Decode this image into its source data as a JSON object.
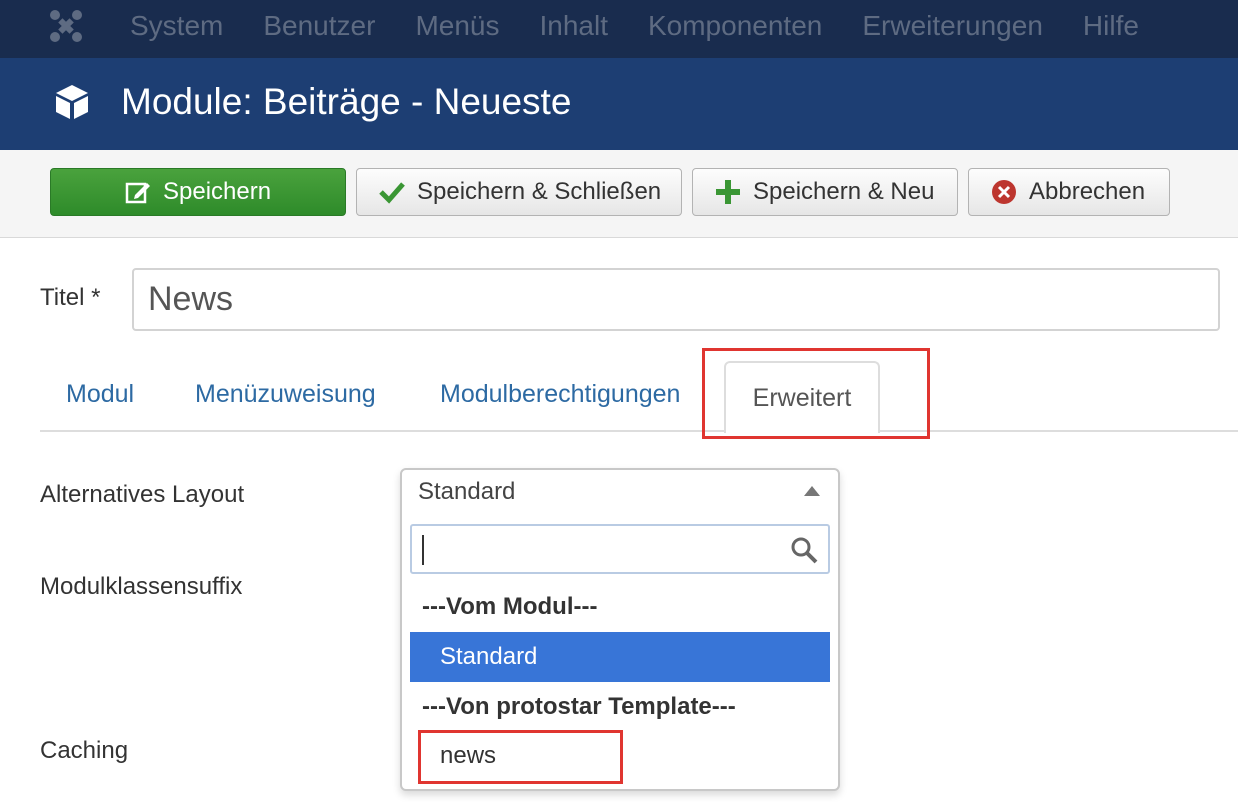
{
  "topnav": {
    "items": [
      "System",
      "Benutzer",
      "Menüs",
      "Inhalt",
      "Komponenten",
      "Erweiterungen",
      "Hilfe"
    ]
  },
  "header": {
    "title": "Module: Beiträge - Neueste"
  },
  "toolbar": {
    "save_label": "Speichern",
    "save_close_label": "Speichern & Schließen",
    "save_new_label": "Speichern & Neu",
    "cancel_label": "Abbrechen"
  },
  "form": {
    "title_label": "Titel *",
    "title_value": "News"
  },
  "tabs": [
    "Modul",
    "Menüzuweisung",
    "Modulberechtigungen",
    "Erweitert"
  ],
  "fields": {
    "layout_label": "Alternatives Layout",
    "suffix_label": "Modulklassensuffix",
    "caching_label": "Caching"
  },
  "dropdown": {
    "selected": "Standard",
    "search_value": "",
    "group1": "---Vom Modul---",
    "option_selected": "Standard",
    "group2": "---Von protostar Template---",
    "option2": "news"
  },
  "colors": {
    "topnav_bg": "#192c4e",
    "header_bg": "#1d3e73",
    "save_green": "#3a9634",
    "highlight_red": "#e03530",
    "selected_blue": "#3875d7",
    "tab_link": "#2d6aa3"
  }
}
